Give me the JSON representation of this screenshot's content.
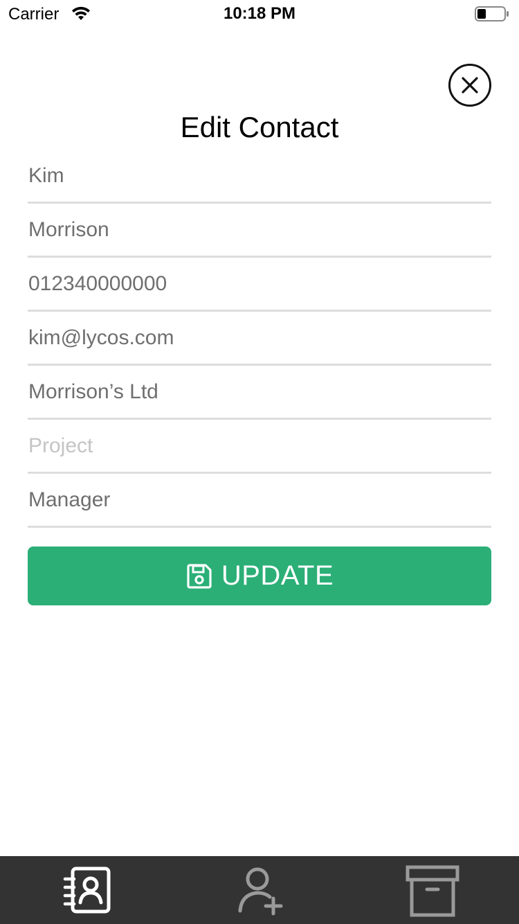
{
  "status_bar": {
    "carrier": "Carrier",
    "time": "10:18 PM"
  },
  "header": {
    "title": "Edit Contact",
    "close_icon": "close-circle-icon"
  },
  "form": {
    "first_name": {
      "value": "Kim",
      "placeholder": ""
    },
    "last_name": {
      "value": "Morrison",
      "placeholder": ""
    },
    "phone": {
      "value": "012340000000",
      "placeholder": ""
    },
    "email": {
      "value": "kim@lycos.com",
      "placeholder": ""
    },
    "company": {
      "value": "Morrison’s Ltd",
      "placeholder": ""
    },
    "project": {
      "value": "",
      "placeholder": "Project"
    },
    "position": {
      "value": "Manager",
      "placeholder": ""
    }
  },
  "update_button": {
    "label": "UPDATE",
    "icon": "save-icon",
    "color": "#2baf77"
  },
  "tab_bar": {
    "background": "#333333",
    "tabs": [
      {
        "icon": "contacts-book-icon",
        "active": true
      },
      {
        "icon": "add-user-icon",
        "active": false
      },
      {
        "icon": "archive-box-icon",
        "active": false
      }
    ]
  }
}
